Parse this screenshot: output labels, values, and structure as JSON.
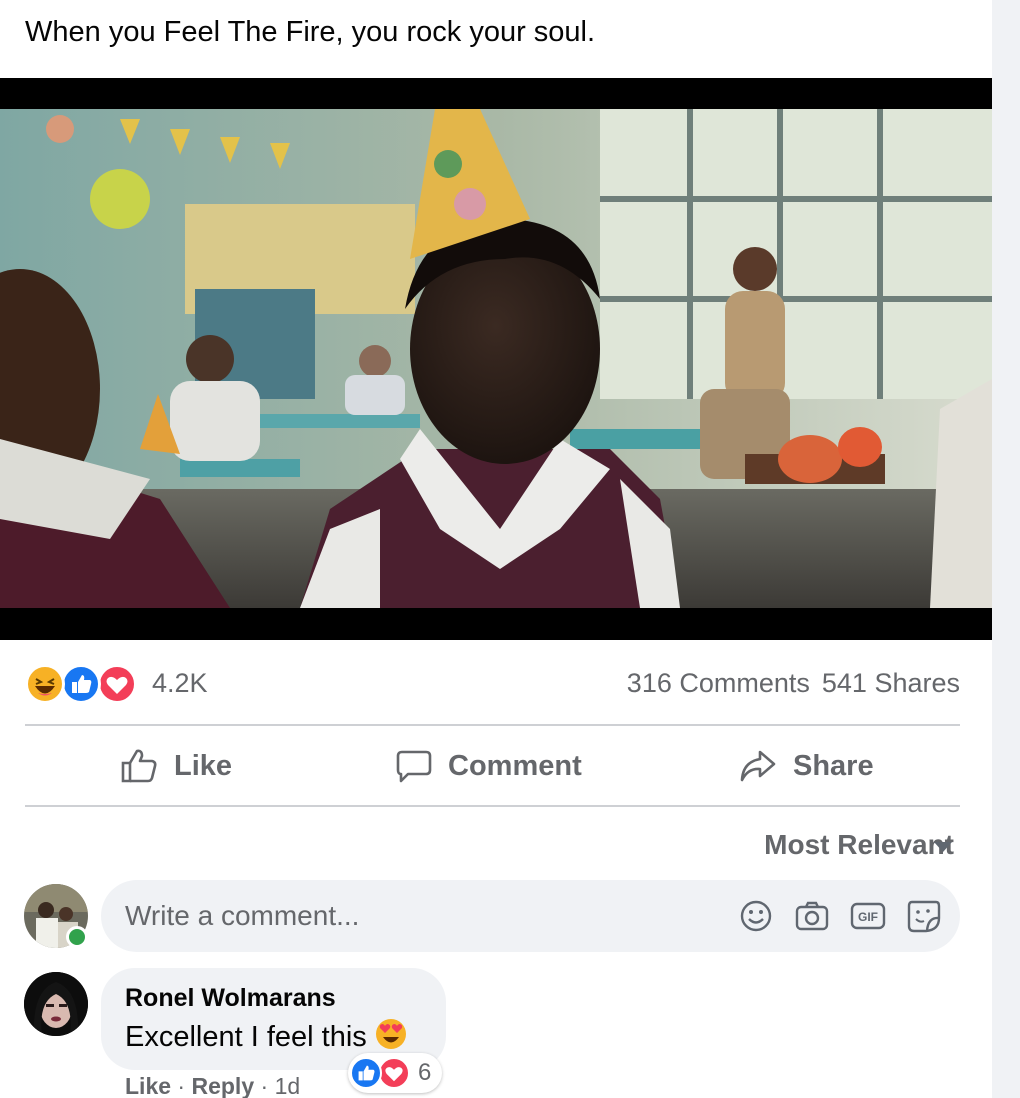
{
  "post": {
    "text": "When you Feel The Fire, you rock your soul."
  },
  "video": {
    "mute_icon": "muted-speaker-icon"
  },
  "stats": {
    "reaction_icons": [
      "haha-icon",
      "like-icon",
      "love-icon"
    ],
    "reaction_count": "4.2K",
    "comments": "316 Comments",
    "shares": "541 Shares"
  },
  "actions": {
    "like": "Like",
    "comment": "Comment",
    "share": "Share"
  },
  "sort": {
    "label": "Most Relevant"
  },
  "composer": {
    "placeholder": "Write a comment...",
    "icons": [
      "emoji-icon",
      "camera-icon",
      "gif-icon",
      "sticker-icon"
    ],
    "gif_label": "GIF"
  },
  "comments": [
    {
      "author": "Ronel Wolmarans",
      "text": "Excellent I feel this",
      "emoji": "heart-eyes-emoji",
      "reaction_icons": [
        "like-icon",
        "love-icon"
      ],
      "reaction_count": "6",
      "like": "Like",
      "reply": "Reply",
      "age": "1d"
    }
  ],
  "colors": {
    "like_blue": "#1877f2",
    "love_red": "#f33e58",
    "haha_yellow": "#f7b125",
    "secondary_text": "#65676b",
    "bubble_bg": "#f0f2f5",
    "online_green": "#31a24c"
  }
}
